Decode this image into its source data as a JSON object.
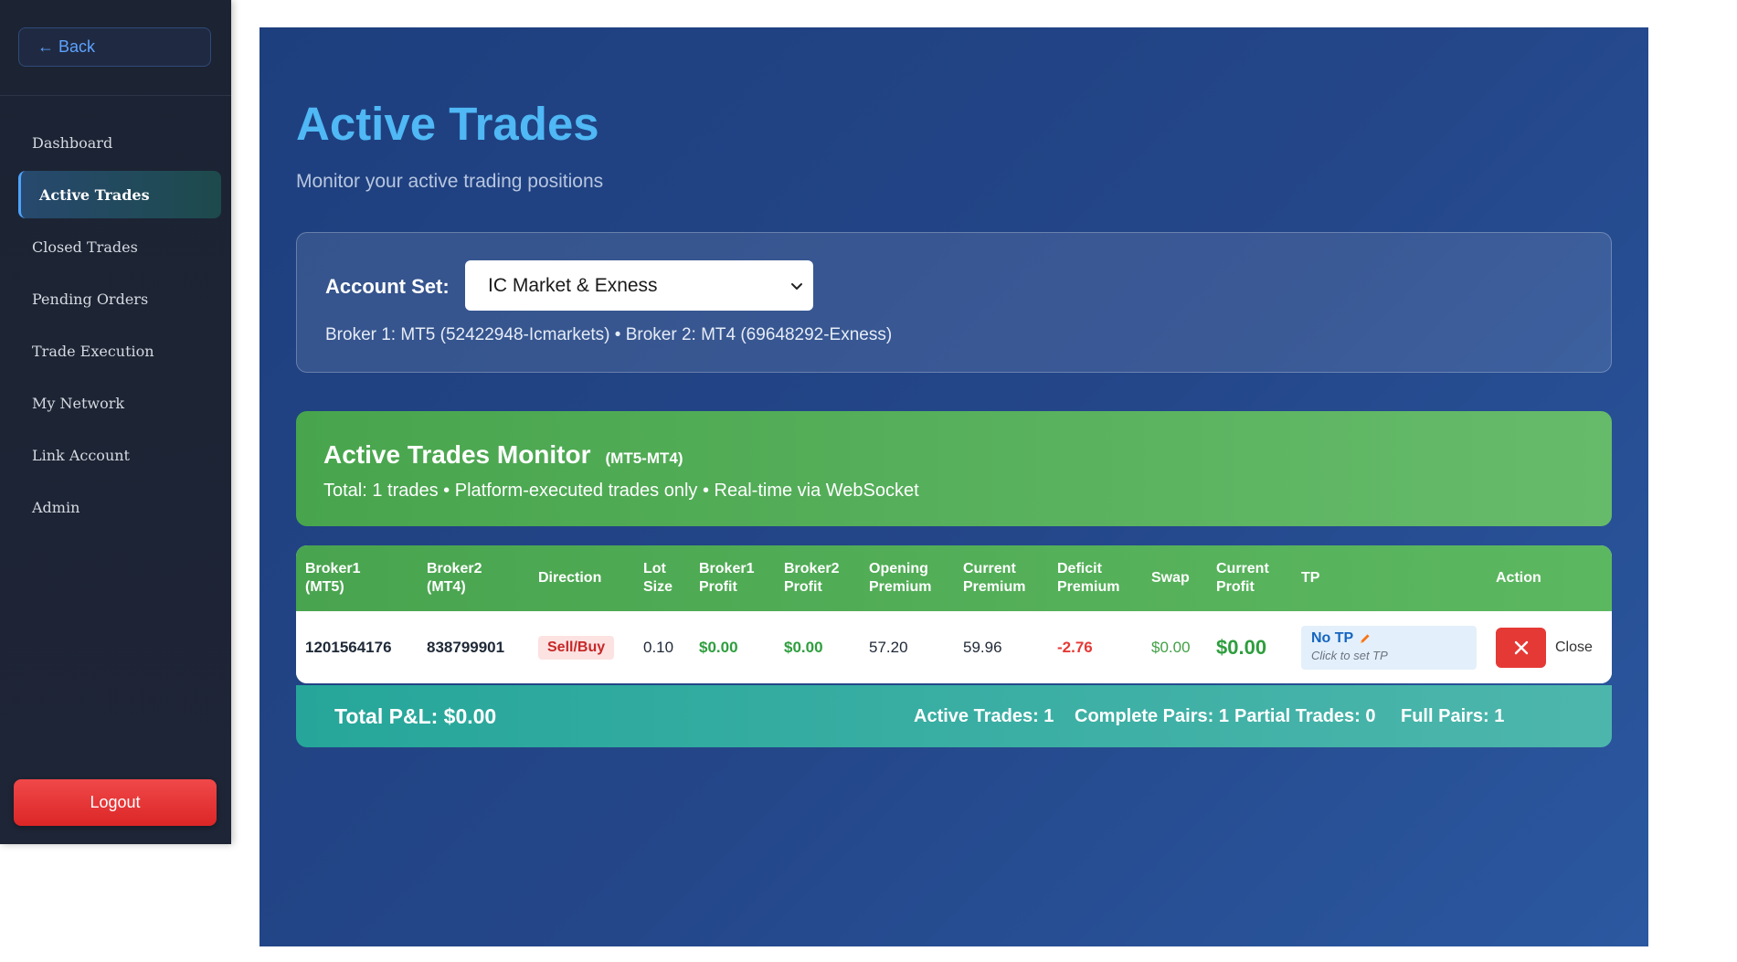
{
  "sidebar": {
    "back_label": "← Back",
    "items": [
      {
        "label": "Dashboard"
      },
      {
        "label": "Active Trades"
      },
      {
        "label": "Closed Trades"
      },
      {
        "label": "Pending Orders"
      },
      {
        "label": "Trade Execution"
      },
      {
        "label": "My Network"
      },
      {
        "label": "Link Account"
      },
      {
        "label": "Admin"
      }
    ],
    "active_item": "Active Trades",
    "logout_label": "Logout"
  },
  "header": {
    "title": "Active Trades",
    "subtitle": "Monitor your active trading positions"
  },
  "account": {
    "label": "Account Set:",
    "selected": "IC Market & Exness",
    "broker_info": "Broker 1: MT5 (52422948-Icmarkets) • Broker 2: MT4 (69648292-Exness)"
  },
  "monitor": {
    "title": "Active Trades Monitor",
    "subtitle": "(MT5-MT4)",
    "description": "Total: 1 trades • Platform-executed trades only • Real-time via WebSocket"
  },
  "table": {
    "headers": [
      {
        "line1": "Broker1",
        "line2": "(MT5)"
      },
      {
        "line1": "Broker2",
        "line2": "(MT4)"
      },
      {
        "line1": "Direction",
        "line2": ""
      },
      {
        "line1": "Lot",
        "line2": "Size"
      },
      {
        "line1": "Broker1",
        "line2": "Profit"
      },
      {
        "line1": "Broker2",
        "line2": "Profit"
      },
      {
        "line1": "Opening",
        "line2": "Premium"
      },
      {
        "line1": "Current",
        "line2": "Premium"
      },
      {
        "line1": "Deficit",
        "line2": "Premium"
      },
      {
        "line1": "Swap",
        "line2": ""
      },
      {
        "line1": "Current",
        "line2": "Profit"
      },
      {
        "line1": "TP",
        "line2": ""
      },
      {
        "line1": "Action",
        "line2": ""
      }
    ],
    "rows": [
      {
        "broker1": "1201564176",
        "broker2": "838799901",
        "direction": "Sell/Buy",
        "lot_size": "0.10",
        "broker1_profit": "$0.00",
        "broker2_profit": "$0.00",
        "opening_premium": "57.20",
        "current_premium": "59.96",
        "deficit_premium": "-2.76",
        "swap": "$0.00",
        "current_profit": "$0.00",
        "tp_label": "No TP",
        "tp_hint": "Click to set TP",
        "close_label": "Close"
      }
    ]
  },
  "totals": {
    "total_pl": "Total P&L: $0.00",
    "active_trades": "Active Trades: 1",
    "complete_pairs": "Complete Pairs: 1",
    "partial_trades": "Partial Trades: 0",
    "full_pairs": "Full Pairs: 1"
  },
  "colors": {
    "sidebar_bg": "#1c2333",
    "main_bg": "#24478a",
    "accent_title": "#4fb8f5",
    "monitor_green": "#4caf50",
    "totals_teal": "#26a69a",
    "danger": "#e53935"
  },
  "icons": [
    "pencil-icon",
    "close-x-icon",
    "chevron-down-icon"
  ]
}
